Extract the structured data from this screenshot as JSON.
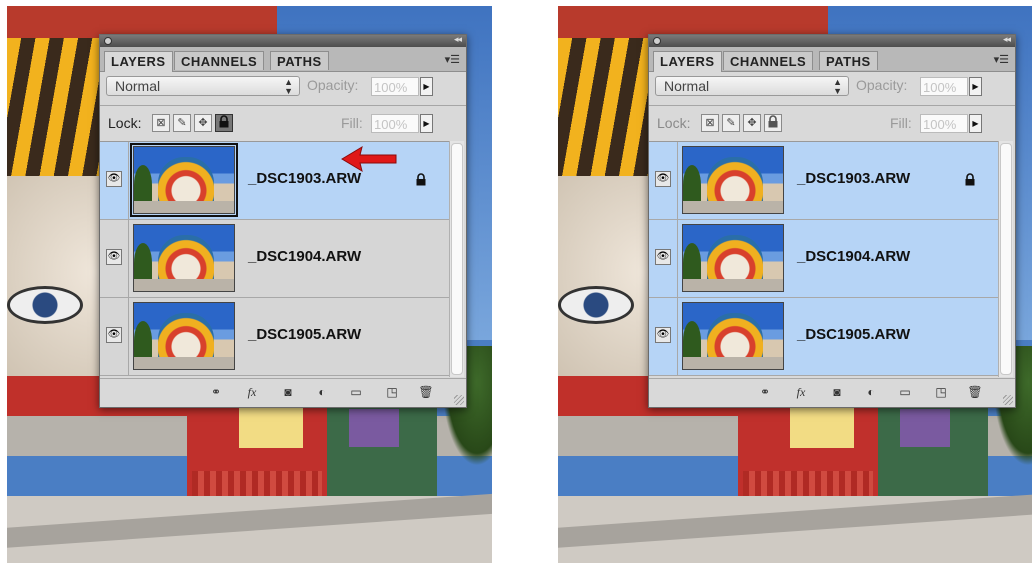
{
  "panels": [
    {
      "tabs": [
        {
          "label": "LAYERS"
        },
        {
          "label": "CHANNELS"
        },
        {
          "label": "PATHS"
        }
      ],
      "blend_mode": "Normal",
      "opacity_label": "Opacity:",
      "opacity_value": "100%",
      "lock_label": "Lock:",
      "fill_label": "Fill:",
      "fill_value": "100%",
      "lock_all_active": true,
      "layers": [
        {
          "name": "_DSC1903.ARW",
          "selected": true,
          "locked": true,
          "thumb_focused": true
        },
        {
          "name": "_DSC1904.ARW",
          "selected": false,
          "locked": false
        },
        {
          "name": "_DSC1905.ARW",
          "selected": false,
          "locked": false
        }
      ]
    },
    {
      "tabs": [
        {
          "label": "LAYERS"
        },
        {
          "label": "CHANNELS"
        },
        {
          "label": "PATHS"
        }
      ],
      "blend_mode": "Normal",
      "opacity_label": "Opacity:",
      "opacity_value": "100%",
      "lock_label": "Lock:",
      "fill_label": "Fill:",
      "fill_value": "100%",
      "lock_all_active": false,
      "layers": [
        {
          "name": "_DSC1903.ARW",
          "selected": true,
          "locked": true
        },
        {
          "name": "_DSC1904.ARW",
          "selected": true,
          "locked": false
        },
        {
          "name": "_DSC1905.ARW",
          "selected": true,
          "locked": false
        }
      ]
    }
  ],
  "colors": {
    "selection": "#b6d4f6",
    "arrow": "#e01818"
  },
  "footer_icons": [
    "link-icon",
    "fx-icon",
    "mask-icon",
    "adjustment-icon",
    "folder-icon",
    "new-layer-icon",
    "trash-icon"
  ]
}
